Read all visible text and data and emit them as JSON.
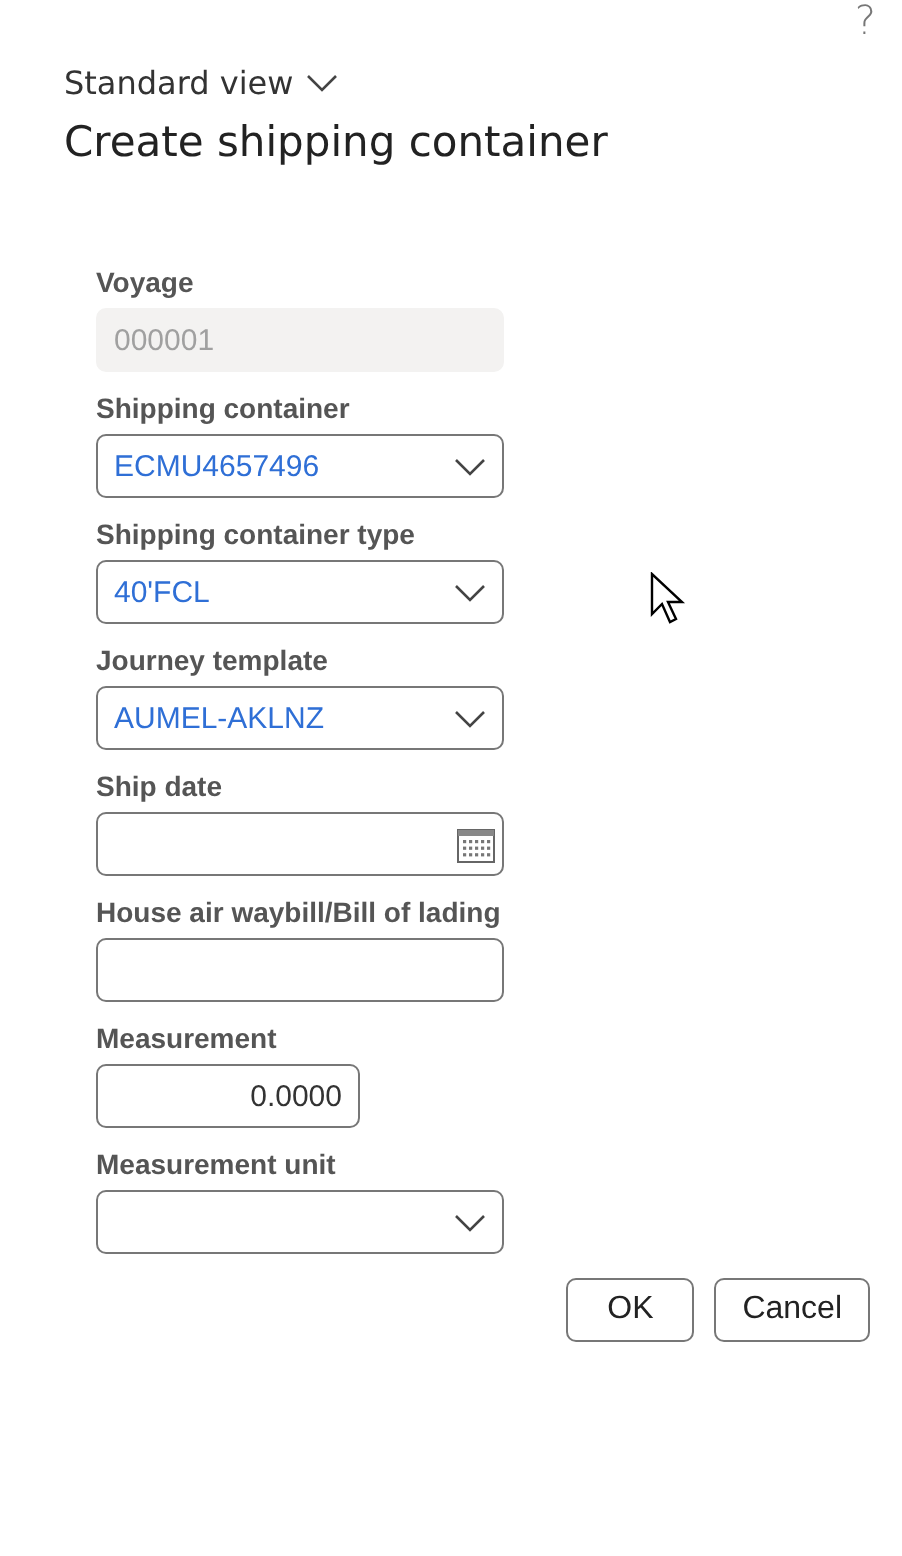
{
  "help": "?",
  "view_selector": {
    "label": "Standard view"
  },
  "title": "Create shipping container",
  "fields": [
    {
      "label": "Voyage",
      "kind": "readonly",
      "value": "000001"
    },
    {
      "label": "Shipping container",
      "kind": "dropdown",
      "value": "ECMU4657496"
    },
    {
      "label": "Shipping container type",
      "kind": "dropdown",
      "value": "40'FCL"
    },
    {
      "label": "Journey template",
      "kind": "dropdown",
      "value": "AUMEL-AKLNZ"
    },
    {
      "label": "Ship date",
      "kind": "date"
    },
    {
      "label": "House air waybill/Bill of lading",
      "kind": "text"
    },
    {
      "label": "Measurement",
      "kind": "number",
      "value": "0.0000"
    },
    {
      "label": "Measurement unit",
      "kind": "dropdown"
    }
  ],
  "buttons": [
    "OK",
    "Cancel"
  ]
}
